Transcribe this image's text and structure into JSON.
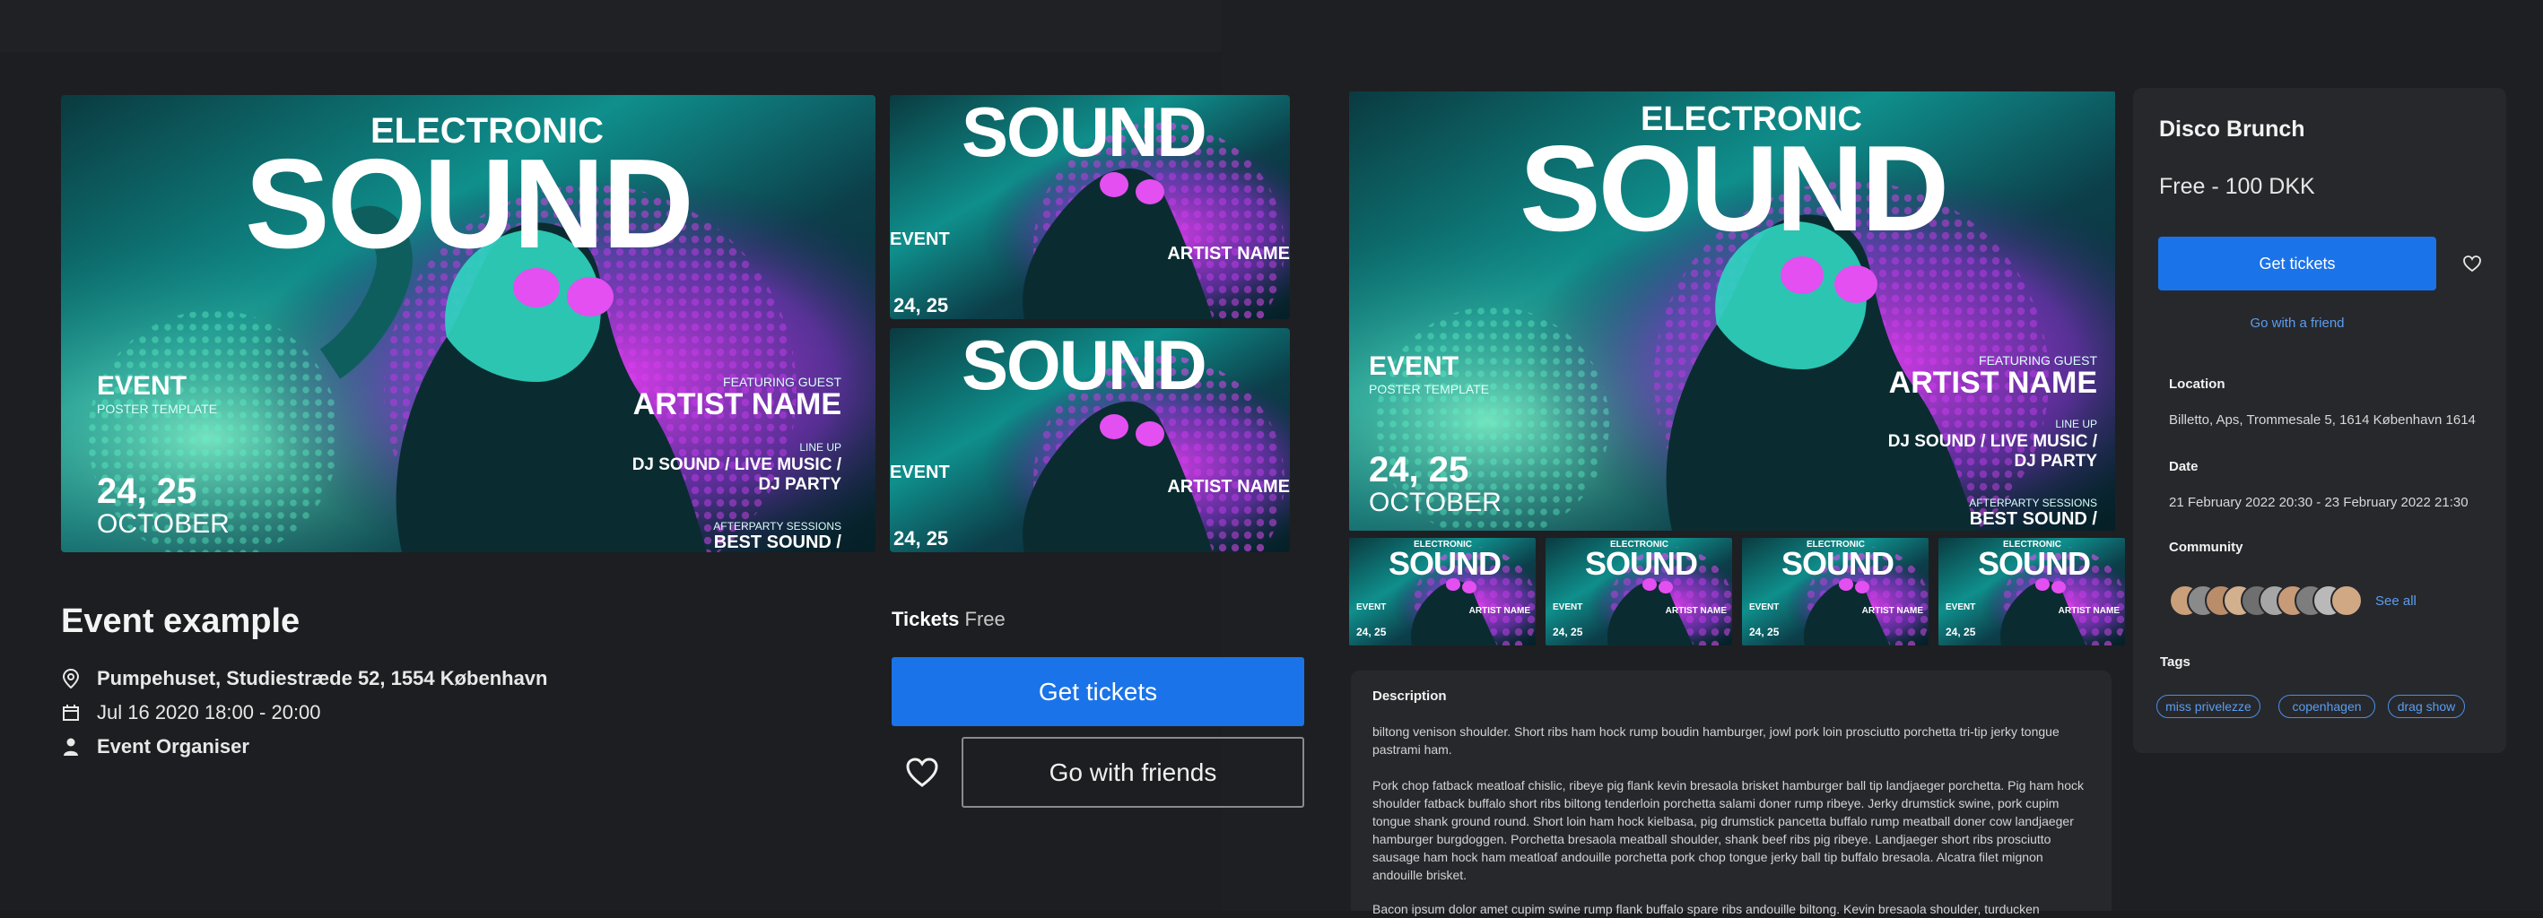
{
  "poster": {
    "headline_small": "ELECTRONIC",
    "headline_big": "SOUND",
    "event": "EVENT",
    "event_sub": "POSTER TEMPLATE",
    "date_line1": "24, 25",
    "date_line2": "OCTOBER",
    "featuring": "FEATURING GUEST",
    "artist": "ARTIST NAME",
    "lineup": "LINE UP",
    "lineup_line1": "DJ SOUND / LIVE MUSIC /",
    "lineup_line2": "DJ PARTY",
    "after": "AFTERPARTY SESSIONS",
    "best": "BEST SOUND /",
    "colors": {
      "teal": "#11c9b6",
      "magenta": "#c92fe3",
      "dark": "#052b33"
    }
  },
  "left_page": {
    "title": "Event example",
    "location": "Pumpehuset, Studiestræde 52, 1554 København",
    "date": "Jul 16 2020 18:00 - 20:00",
    "organiser": "Event Organiser",
    "tickets_label": "Tickets",
    "tickets_value": "Free",
    "get_tickets": "Get tickets",
    "go_with_friends": "Go with friends"
  },
  "right_page": {
    "title": "Disco Brunch",
    "price": "Free - 100 DKK",
    "get_tickets": "Get tickets",
    "go_with_friend": "Go with a friend",
    "location_label": "Location",
    "location_value": "Billetto, Aps, Trommesale 5, 1614 København 1614",
    "date_label": "Date",
    "date_value": "21 February 2022 20:30 - 23 February 2022 21:30",
    "community_label": "Community",
    "see_all": "See all",
    "tags_label": "Tags",
    "tags": [
      "miss privelezze",
      "copenhagen",
      "drag show"
    ],
    "description_label": "Description",
    "description": [
      "biltong venison shoulder. Short ribs ham hock rump boudin hamburger, jowl pork loin prosciutto porchetta tri-tip jerky tongue pastrami ham.",
      "Pork chop fatback meatloaf chislic, ribeye pig flank kevin bresaola brisket hamburger ball tip landjaeger porchetta. Pig ham hock shoulder fatback buffalo short ribs biltong tenderloin porchetta salami doner rump ribeye. Jerky drumstick swine, pork cupim tongue shank ground round. Short loin ham hock kielbasa, pig drumstick pancetta buffalo rump meatball doner cow landjaeger hamburger burgdoggen. Porchetta bresaola meatball shoulder, shank beef ribs pig ribeye. Landjaeger short ribs prosciutto sausage ham hock ham meatloaf andouille porchetta pork chop tongue jerky ball tip buffalo bresaola. Alcatra filet mignon andouille brisket.",
      "Bacon ipsum dolor amet cupim swine rump flank buffalo spare ribs andouille biltong. Kevin bresaola shoulder, turducken"
    ]
  }
}
